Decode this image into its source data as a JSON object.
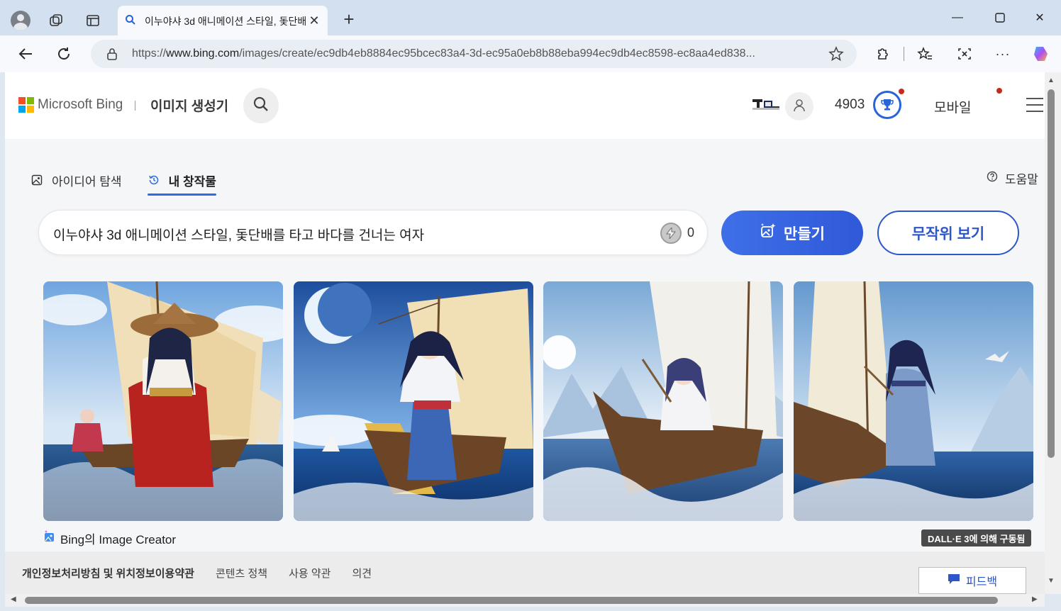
{
  "browser": {
    "tab_title": "이누야샤 3d 애니메이션 스타일, 돛단배를 타고",
    "url_prefix": "https://",
    "url_host": "www.bing.com",
    "url_path": "/images/create/ec9db4eb8884ec95bcec83a4-3d-ec95a0eb8b88eba994ec9db4ec8598-ec8aa4ed838...",
    "new_tab_label": "+"
  },
  "header": {
    "brand": "Microsoft Bing",
    "product": "이미지 생성기",
    "points": "4903",
    "mobile": "모바일"
  },
  "tabs": [
    {
      "label": "아이디어 탐색",
      "icon": "image-icon"
    },
    {
      "label": "내 창작물",
      "icon": "history-icon"
    }
  ],
  "help": "도움말",
  "prompt": {
    "text": "이누야샤 3d 애니메이션 스타일, 돛단배를 타고 바다를 건너는 여자",
    "boost_count": "0"
  },
  "buttons": {
    "create": "만들기",
    "random": "무작위 보기"
  },
  "gallery_label": "Bing의 Image Creator",
  "dalle_badge": "DALL·E 3에 의해 구동됨",
  "footer": {
    "links": [
      "개인정보처리방침 및 위치정보이용약관",
      "콘텐츠 정책",
      "사용 약관",
      "의견"
    ]
  },
  "feedback": "피드백",
  "colors": {
    "accent": "#2d56c8",
    "create_button": "#3f6fe8",
    "notification": "#c42b1c"
  }
}
